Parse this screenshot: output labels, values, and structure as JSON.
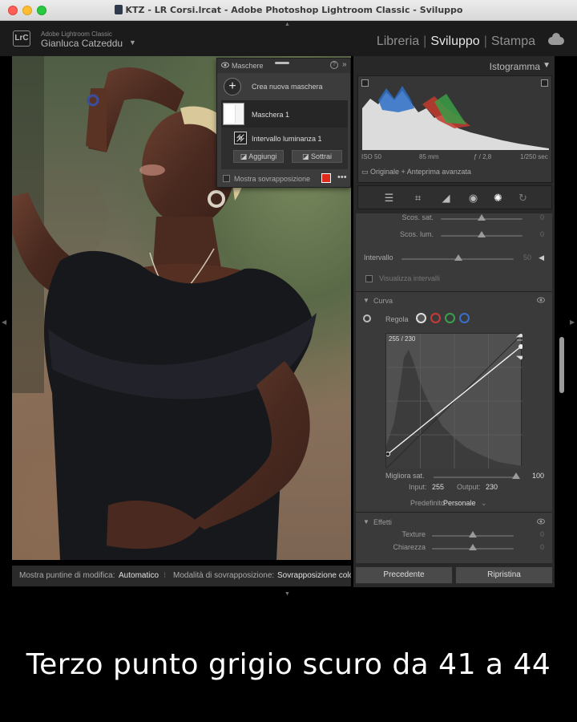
{
  "window": {
    "title": "KTZ - LR Corsi.lrcat - Adobe Photoshop Lightroom Classic - Sviluppo"
  },
  "header": {
    "logo": "LrC",
    "app_name": "Adobe Lightroom Classic",
    "user": "Gianluca Catzeddu",
    "modules": {
      "library": "Libreria",
      "develop": "Sviluppo",
      "print": "Stampa"
    }
  },
  "masks": {
    "title": "Maschere",
    "help": "?",
    "collapse": "»",
    "create_new": "Crea nuova maschera",
    "mask1": "Maschera 1",
    "luminance_range": "Intervallo luminanza 1",
    "add": "Aggiungi",
    "subtract": "Sottrai",
    "show_overlay": "Mostra sovrapposizione",
    "overlay_color": "#e02a1b"
  },
  "toolbar": {
    "show_pins_label": "Mostra puntine di modifica:",
    "show_pins_value": "Automatico",
    "overlay_mode_label": "Modalità di sovrapposizione:",
    "overlay_mode_value": "Sovrapposizione colo"
  },
  "histogram": {
    "title": "Istogramma",
    "iso": "ISO 50",
    "focal": "85 mm",
    "aperture": "ƒ / 2,8",
    "shutter": "1/250 sec",
    "preview": "Originale + Anteprima avanzata"
  },
  "sliders": {
    "sat_shift": {
      "label": "Scos. sat.",
      "value": "0"
    },
    "lum_shift": {
      "label": "Scos. lum.",
      "value": "0"
    },
    "range": {
      "label": "Intervallo",
      "value": "50"
    },
    "show_ranges": "Visualizza intervalli"
  },
  "curve": {
    "title": "Curva",
    "adjust": "Regola",
    "readout": "255 / 230",
    "enhance_sat_label": "Migliora sat.",
    "enhance_sat_value": "100",
    "enhance_sat_level": 1.0,
    "input_label": "Input:",
    "input_value": "255",
    "output_label": "Output:",
    "output_value": "230",
    "preset_label": "Predefinito:",
    "preset_value": "Personale"
  },
  "effects": {
    "title": "Effetti",
    "texture": {
      "label": "Texture",
      "value": "0"
    },
    "clarity": {
      "label": "Chiarezza",
      "value": "0"
    }
  },
  "buttons": {
    "previous": "Precedente",
    "reset": "Ripristina"
  },
  "caption": "Terzo punto grigio scuro da 41 a 44"
}
